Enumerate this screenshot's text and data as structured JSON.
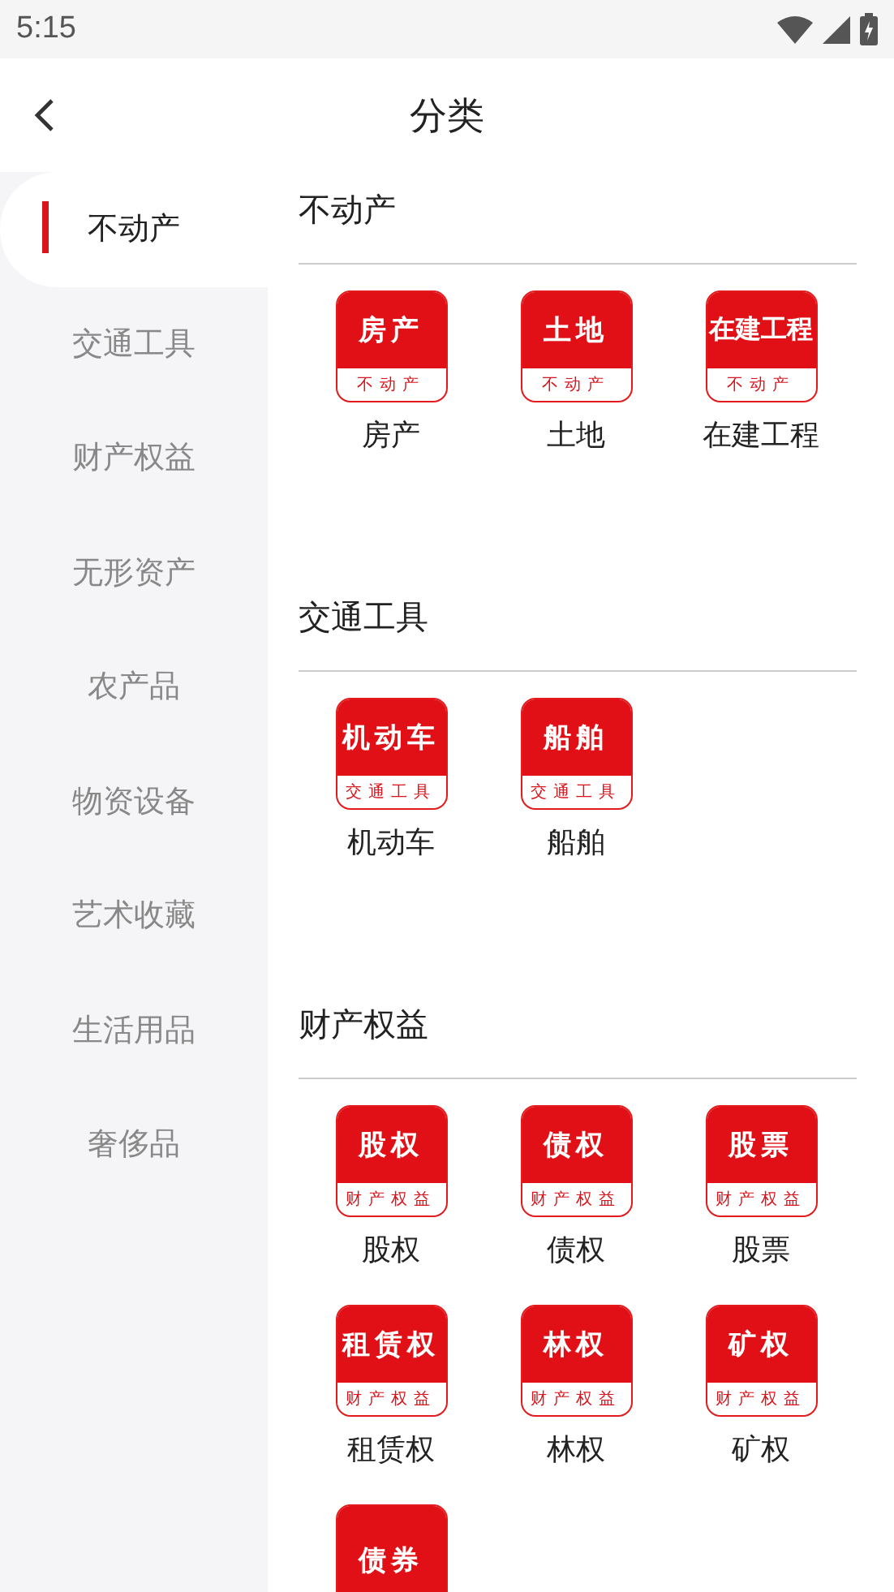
{
  "status_bar": {
    "time": "5:15"
  },
  "header": {
    "title": "分类"
  },
  "sidebar": {
    "items": [
      {
        "label": "不动产",
        "selected": true
      },
      {
        "label": "交通工具",
        "selected": false
      },
      {
        "label": "财产权益",
        "selected": false
      },
      {
        "label": "无形资产",
        "selected": false
      },
      {
        "label": "农产品",
        "selected": false
      },
      {
        "label": "物资设备",
        "selected": false
      },
      {
        "label": "艺术收藏",
        "selected": false
      },
      {
        "label": "生活用品",
        "selected": false
      },
      {
        "label": "奢侈品",
        "selected": false
      }
    ]
  },
  "sections": [
    {
      "title": "不动产",
      "items": [
        {
          "icon_top": "房产",
          "icon_bottom": "不动产",
          "label": "房产"
        },
        {
          "icon_top": "土地",
          "icon_bottom": "不动产",
          "label": "土地"
        },
        {
          "icon_top": "在建工程",
          "icon_bottom": "不动产",
          "label": "在建工程"
        }
      ]
    },
    {
      "title": "交通工具",
      "items": [
        {
          "icon_top": "机动车",
          "icon_bottom": "交通工具",
          "label": "机动车"
        },
        {
          "icon_top": "船舶",
          "icon_bottom": "交通工具",
          "label": "船舶"
        }
      ]
    },
    {
      "title": "财产权益",
      "items": [
        {
          "icon_top": "股权",
          "icon_bottom": "财产权益",
          "label": "股权"
        },
        {
          "icon_top": "债权",
          "icon_bottom": "财产权益",
          "label": "债权"
        },
        {
          "icon_top": "股票",
          "icon_bottom": "财产权益",
          "label": "股票"
        },
        {
          "icon_top": "租赁权",
          "icon_bottom": "财产权益",
          "label": "租赁权"
        },
        {
          "icon_top": "林权",
          "icon_bottom": "财产权益",
          "label": "林权"
        },
        {
          "icon_top": "矿权",
          "icon_bottom": "财产权益",
          "label": "矿权"
        },
        {
          "icon_top": "债券"
        }
      ]
    }
  ]
}
